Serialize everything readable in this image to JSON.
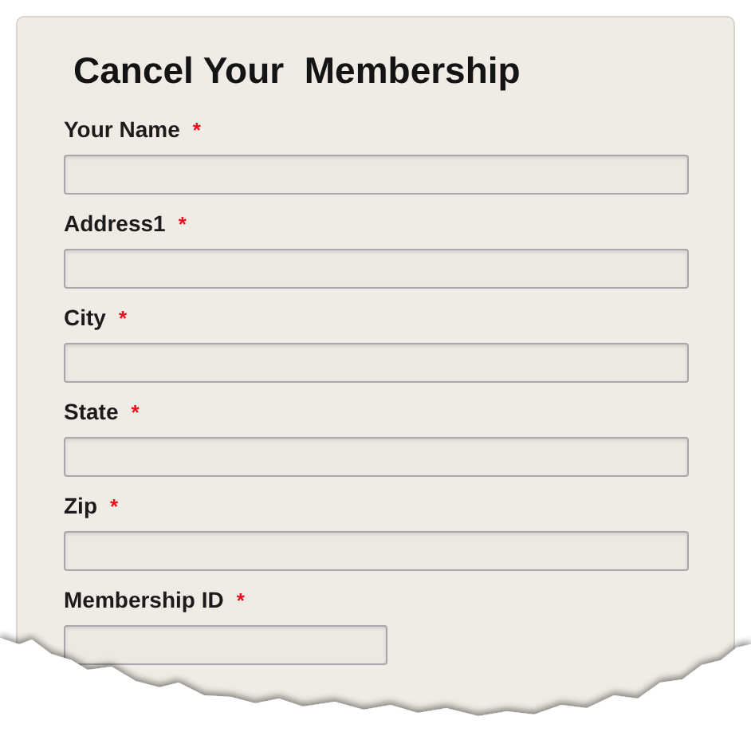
{
  "title": "Cancel Your  Membership",
  "fields": [
    {
      "label": "Your Name",
      "required_mark": "*",
      "kind": "wide"
    },
    {
      "label": "Address1",
      "required_mark": "*",
      "kind": "wide"
    },
    {
      "label": "City",
      "required_mark": "*",
      "kind": "wide"
    },
    {
      "label": "State",
      "required_mark": "*",
      "kind": "wide"
    },
    {
      "label": "Zip",
      "required_mark": "*",
      "kind": "wide"
    },
    {
      "label": "Membership ID",
      "required_mark": "*",
      "kind": "short"
    }
  ]
}
